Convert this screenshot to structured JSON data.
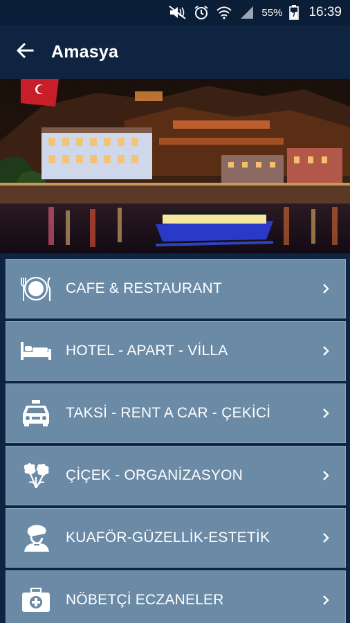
{
  "status_bar": {
    "battery_percent": "55%",
    "time": "16:39",
    "icons": [
      "mute-icon",
      "alarm-icon",
      "wifi-icon",
      "signal-icon",
      "battery-icon"
    ]
  },
  "app_bar": {
    "title": "Amasya",
    "back_icon": "arrow-left-icon"
  },
  "hero": {
    "description_icon": "city-night-photo"
  },
  "menu": {
    "items": [
      {
        "label": "CAFE & RESTAURANT",
        "icon": "plate-cutlery-icon"
      },
      {
        "label": "HOTEL - APART - VİLLA",
        "icon": "bed-icon"
      },
      {
        "label": "TAKSİ - RENT A CAR - ÇEKİCİ",
        "icon": "taxi-icon"
      },
      {
        "label": "ÇİÇEK - ORGANİZASYON",
        "icon": "flowers-icon"
      },
      {
        "label": "KUAFÖR-GÜZELLİK-ESTETİK",
        "icon": "hairdresser-icon"
      },
      {
        "label": "NÖBETÇİ ECZANELER",
        "icon": "first-aid-kit-icon"
      }
    ]
  },
  "colors": {
    "primary_dark": "#0e2440",
    "status_bar": "#0b1e37",
    "menu_item_bg": "#6a8aa6",
    "text": "#ffffff"
  }
}
